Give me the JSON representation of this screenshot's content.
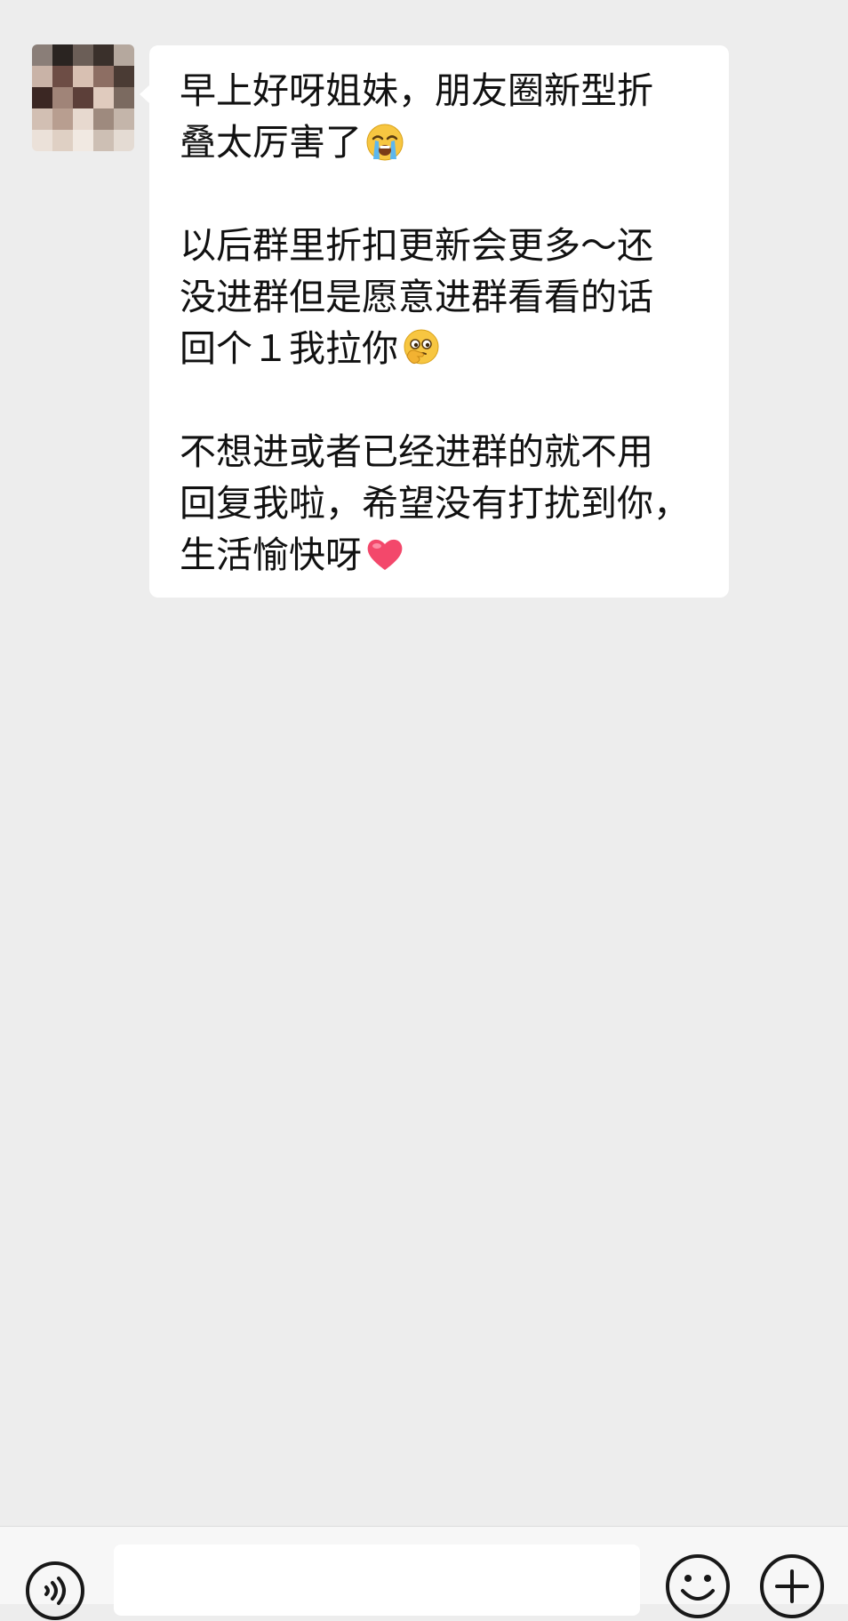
{
  "chat": {
    "message": {
      "paragraphs": [
        {
          "lines": [
            {
              "text": "早上好呀姐妹，朋友圈新型折"
            },
            {
              "text": "叠太厉害了",
              "emoji": "loudly-crying-face-icon"
            }
          ]
        },
        {
          "lines": [
            {
              "text": "以后群里折扣更新会更多～还"
            },
            {
              "text": "没进群但是愿意进群看看的话"
            },
            {
              "text": "回个１我拉你",
              "emoji": "thinking-face-icon"
            }
          ]
        },
        {
          "lines": [
            {
              "text": "不想进或者已经进群的就不用"
            },
            {
              "text": "回复我啦，希望没有打扰到你，"
            },
            {
              "text": "生活愉快呀",
              "emoji": "red-heart-icon"
            }
          ]
        }
      ]
    }
  },
  "input_bar": {
    "input_value": "",
    "icons": {
      "voice": "voice-icon",
      "emoji": "emoji-icon",
      "more": "plus-icon"
    }
  },
  "colors": {
    "chat_background": "#ededed",
    "bubble_background": "#ffffff",
    "input_bar_background": "#f7f7f7",
    "text": "#111111"
  }
}
